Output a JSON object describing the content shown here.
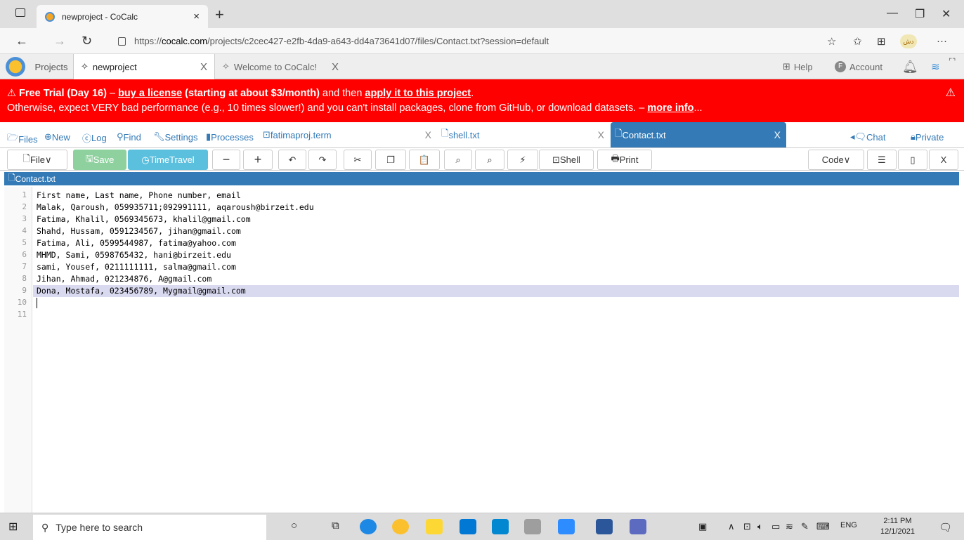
{
  "browser": {
    "tab_title": "newproject - CoCalc",
    "tab_close": "×",
    "new_tab": "+",
    "url_prefix": "https://",
    "url_host": "cocalc.com",
    "url_path": "/projects/c2cec427-e2fb-4da9-a643-dd4a73641d07/files/Contact.txt?session=default",
    "profile_badge": "دش",
    "menu": "···"
  },
  "cocalc_nav": {
    "projects_label": "Projects",
    "tabs": [
      {
        "label": "newproject",
        "close": "X"
      },
      {
        "label": "Welcome to CoCalc!",
        "close": "X"
      }
    ],
    "help": "Help",
    "account_initial": "F",
    "account": "Account"
  },
  "banner": {
    "title": "Free Trial (Day 16)",
    "dash1": " – ",
    "buy": "buy a license",
    "pricing": " (starting at about $3/month)",
    "then": " and then ",
    "apply": "apply it to this project",
    "period": ".",
    "line2": "Otherwise, expect VERY bad performance (e.g., 10 times slower!) and you can't install packages, clone from GitHub, or download datasets. – ",
    "more_info": "more info",
    "ellipsis": "..."
  },
  "file_nav": {
    "files": "Files",
    "new": "New",
    "log": "Log",
    "find": "Find",
    "settings": "Settings",
    "processes": "Processes",
    "tabs": [
      {
        "label": "fatimaproj.term",
        "close": "X"
      },
      {
        "label": "shell.txt",
        "close": "X"
      },
      {
        "label": "Contact.txt",
        "close": "X"
      }
    ],
    "chat": "Chat",
    "private": "Private"
  },
  "toolbar": {
    "file": "File",
    "save": "Save",
    "timetravel": "TimeTravel",
    "minus": "−",
    "plus": "+",
    "undo": "↶",
    "redo": "↷",
    "cut": "✂",
    "copy": "❐",
    "paste": "📋",
    "find": "⌕",
    "replace": "⌕",
    "format": "⚡",
    "shell": "Shell",
    "print": "Print",
    "mode": "Code",
    "split_h": "☰",
    "split_v": "▯",
    "close": "X"
  },
  "file_title": "Contact.txt",
  "editor": {
    "lines": [
      "First name, Last name, Phone number, email",
      "Malak, Qaroush, 059935711;092991111, aqaroush@birzeit.edu",
      "Fatima, Khalil, 0569345673, khalil@gmail.com",
      "Shahd, Hussam, 0591234567, jihan@gmail.com",
      "Fatima, Ali, 0599544987, fatima@yahoo.com",
      "MHMD, Sami, 0598765432, hani@birzeit.edu",
      "sami, Yousef, 0211111111, salma@gmail.com",
      "Jihan, Ahmad, 021234876, A@gmail.com",
      "Dona, Mostafa, 023456789, Mygmail@gmail.com",
      "",
      ""
    ],
    "line_numbers": [
      "1",
      "2",
      "3",
      "4",
      "5",
      "6",
      "7",
      "8",
      "9",
      "10",
      "11"
    ]
  },
  "taskbar": {
    "search_placeholder": "Type here to search",
    "lang": "ENG",
    "time": "2:11 PM",
    "date": "12/1/2021"
  },
  "colors": {
    "banner": "#ff0000",
    "active_tab": "#337ab7",
    "save": "#8fd19e",
    "timetravel": "#5bc0de",
    "highlight": "#d9d9f0"
  }
}
